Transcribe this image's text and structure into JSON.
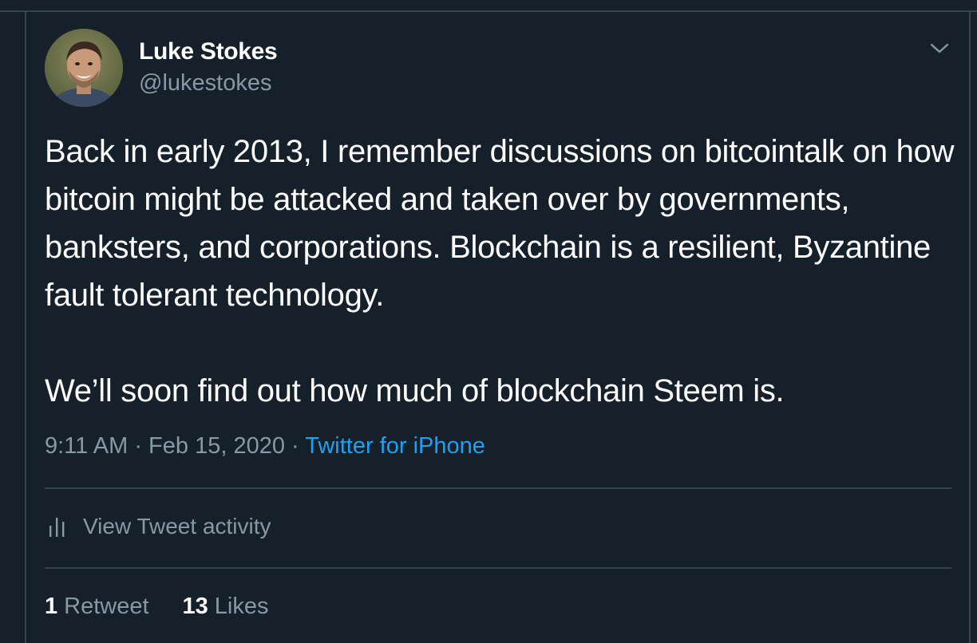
{
  "author": {
    "name": "Luke Stokes",
    "handle": "@lukestokes"
  },
  "tweet": {
    "paragraphs": [
      "Back in early 2013, I remember discussions on bitcointalk on how bitcoin might be attacked and taken over by governments, banksters, and corporations. Blockchain is a resilient, Byzantine fault tolerant technology.",
      "We’ll soon find out how much of blockchain Steem is."
    ],
    "time": "9:11 AM",
    "separator": "·",
    "date": "Feb 15, 2020",
    "source": "Twitter for iPhone"
  },
  "activity": {
    "label": "View Tweet activity",
    "icon": "bar-chart-icon"
  },
  "stats": {
    "retweets_count": "1",
    "retweets_label": "Retweet",
    "likes_count": "13",
    "likes_label": "Likes"
  },
  "icons": {
    "menu": "chevron-down-icon"
  },
  "colors": {
    "background": "#15202b",
    "border": "#38444d",
    "text_primary": "#ffffff",
    "text_secondary": "#8899a6",
    "accent": "#1da1f2"
  }
}
